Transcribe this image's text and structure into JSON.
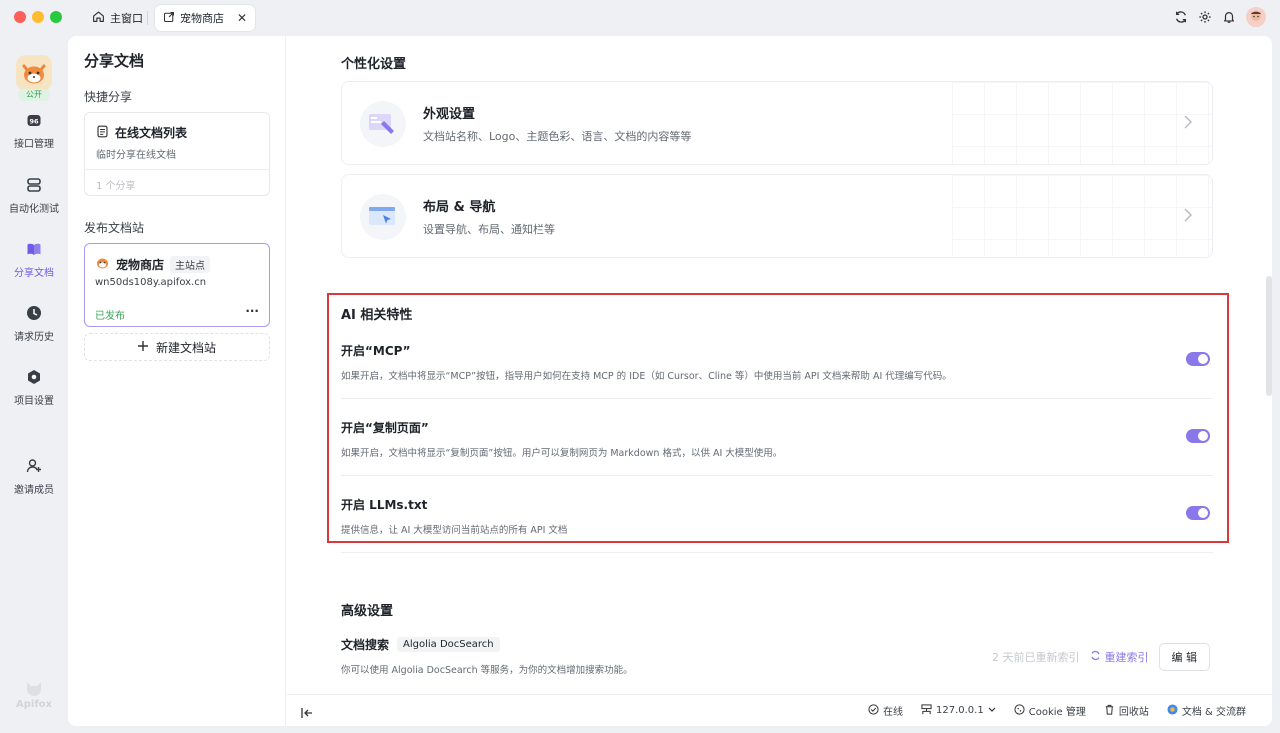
{
  "titlebar": {
    "tabs": [
      {
        "label": "主窗口",
        "icon": "home-icon"
      },
      {
        "label": "宠物商店",
        "icon": "share-doc-icon",
        "close": "✕"
      }
    ]
  },
  "rail": {
    "project_badge": "公开",
    "items": [
      {
        "label": "接口管理",
        "icon": "api-icon"
      },
      {
        "label": "自动化测试",
        "icon": "automation-icon"
      },
      {
        "label": "分享文档",
        "icon": "book-icon",
        "active": true
      },
      {
        "label": "请求历史",
        "icon": "clock-icon"
      },
      {
        "label": "项目设置",
        "icon": "settings-icon"
      },
      {
        "label": "邀请成员",
        "icon": "add-user-icon"
      }
    ],
    "watermark": "Apifox"
  },
  "side": {
    "title": "分享文档",
    "quick_share_label": "快捷分享",
    "online_card": {
      "title": "在线文档列表",
      "desc": "临时分享在线文档",
      "count": "1 个分享"
    },
    "publish_label": "发布文档站",
    "site_card": {
      "name": "宠物商店",
      "tag": "主站点",
      "url": "wn50ds108y.apifox.cn",
      "status": "已发布",
      "more": "···"
    },
    "new_site": "新建文档站"
  },
  "content": {
    "personal_title": "个性化设置",
    "cards": [
      {
        "title": "外观设置",
        "desc": "文档站名称、Logo、主题色彩、语言、文档的内容等等"
      },
      {
        "title": "布局 & 导航",
        "desc": "设置导航、布局、通知栏等"
      }
    ],
    "ai_title": "AI 相关特性",
    "features": [
      {
        "title": "开启“MCP”",
        "desc": "如果开启，文档中将显示“MCP”按钮，指导用户如何在支持 MCP 的 IDE（如 Cursor、Cline 等）中使用当前 API 文档来帮助 AI 代理编写代码。",
        "enabled": true
      },
      {
        "title": "开启“复制页面”",
        "desc": "如果开启，文档中将显示“复制页面”按钮。用户可以复制网页为 Markdown 格式，以供 AI 大模型使用。",
        "enabled": true
      },
      {
        "title": "开启 LLMs.txt",
        "desc": "提供信息，让 AI 大模型访问当前站点的所有 API 文档",
        "enabled": true
      }
    ],
    "advanced_title": "高级设置",
    "search": {
      "title": "文档搜索",
      "tag": "Algolia DocSearch",
      "desc": "你可以使用 Algolia DocSearch 等服务，为你的文档增加搜索功能。",
      "reindexed": "2 天前已重新索引",
      "reindex": "重建索引",
      "edit": "编 辑"
    }
  },
  "statusbar": {
    "online": "在线",
    "host": "127.0.0.1",
    "cookie": "Cookie 管理",
    "recycle": "回收站",
    "community": "文档 & 交流群"
  },
  "colors": {
    "accent": "#8a78ea",
    "highlight_border": "#d9393b",
    "published": "#3aa65a"
  }
}
